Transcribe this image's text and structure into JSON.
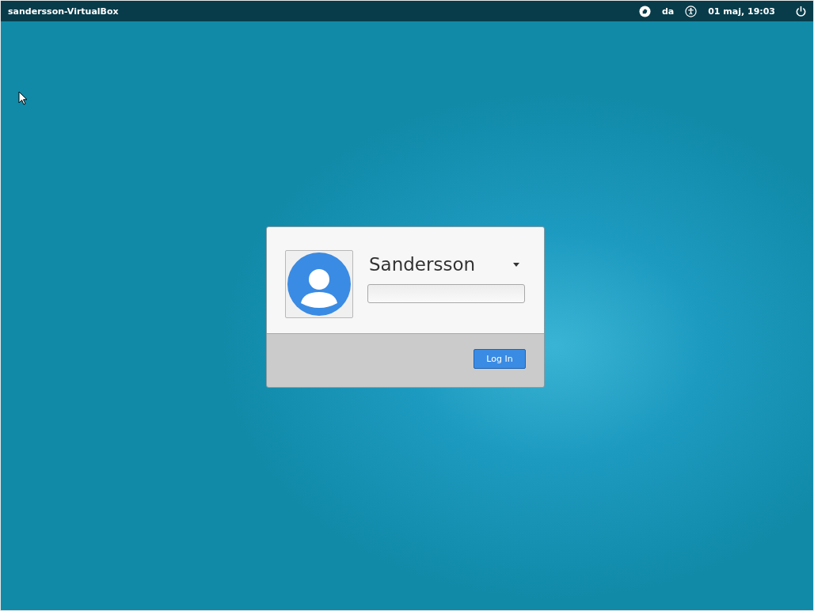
{
  "top_bar": {
    "hostname": "sandersson-VirtualBox",
    "keyboard_layout": "da",
    "clock": "01 maj, 19:03"
  },
  "login_dialog": {
    "user_name": "Sandersson",
    "login_button": "Log In"
  }
}
